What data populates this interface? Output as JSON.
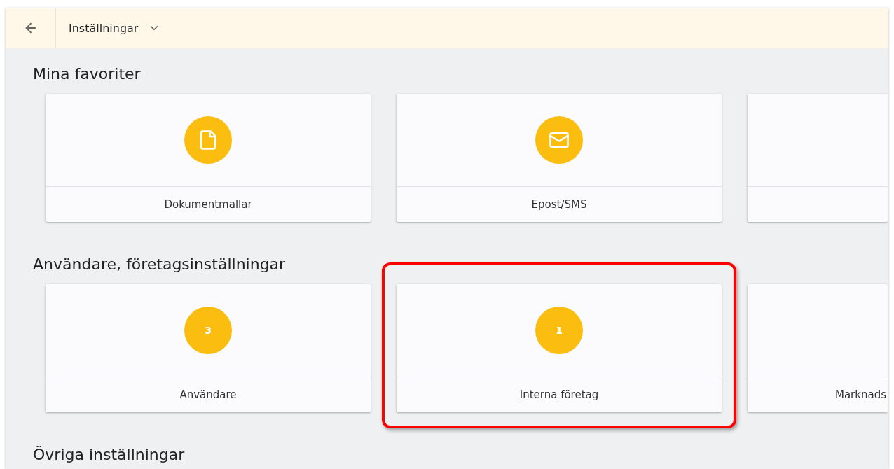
{
  "header": {
    "title": "Inställningar"
  },
  "sections": [
    {
      "title": "Mina favoriter",
      "cards": [
        {
          "kind": "icon",
          "label": "Dokumentmallar",
          "highlighted": false
        },
        {
          "kind": "icon",
          "label": "Epost/SMS",
          "highlighted": false
        },
        {
          "kind": "partial",
          "highlighted": false
        }
      ]
    },
    {
      "title": "Användare, företagsinställningar",
      "cards": [
        {
          "kind": "count",
          "count": "3",
          "label": "Användare",
          "highlighted": false
        },
        {
          "kind": "count",
          "count": "1",
          "label": "Interna företag",
          "highlighted": true
        },
        {
          "kind": "partial",
          "label": "Marknads",
          "highlighted": false
        }
      ]
    },
    {
      "title": "Övriga inställningar"
    }
  ]
}
